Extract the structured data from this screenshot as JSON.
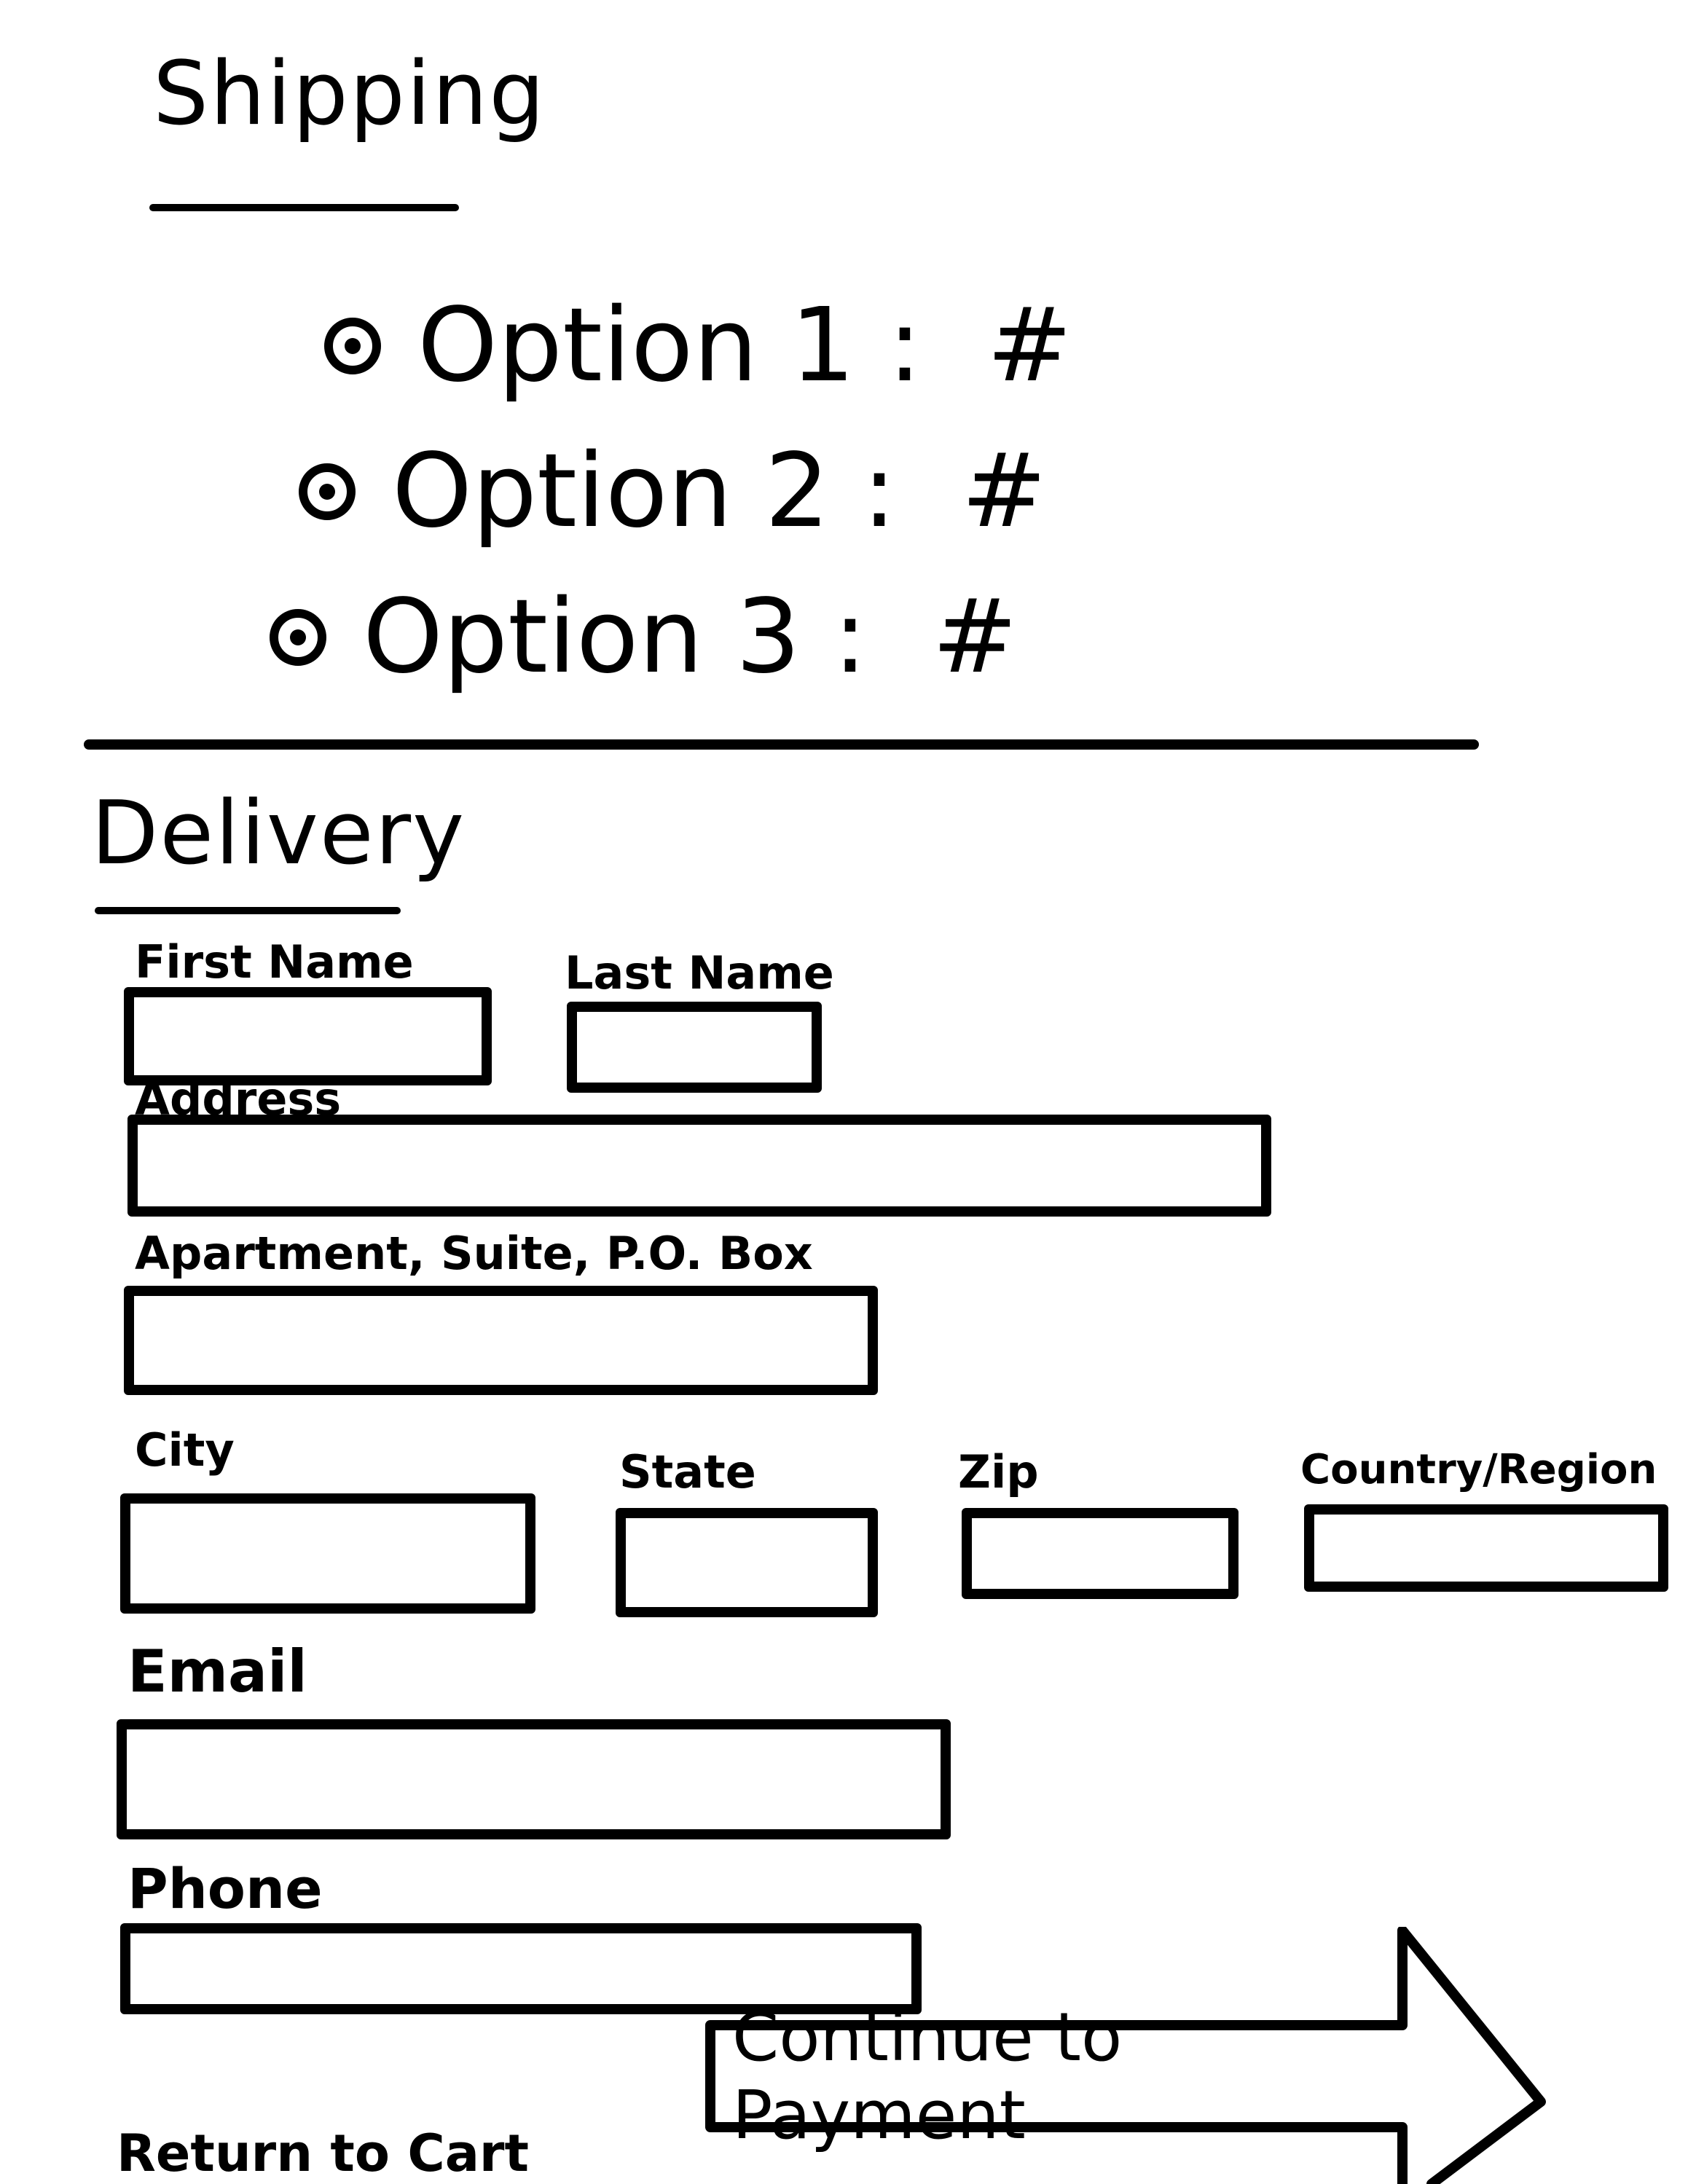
{
  "shipping": {
    "title": "Shipping",
    "options": [
      {
        "label": "Option 1 :  #"
      },
      {
        "label": "Option 2 :  #"
      },
      {
        "label": "Option 3 :  #"
      }
    ]
  },
  "delivery": {
    "title": "Delivery",
    "fields": {
      "first_name": "First Name",
      "last_name": "Last Name",
      "address": "Address",
      "apartment": "Apartment, Suite, P.O. Box",
      "city": "City",
      "state": "State",
      "zip": "Zip",
      "country": "Country/Region",
      "email": "Email",
      "phone": "Phone"
    }
  },
  "actions": {
    "continue_label": "Continue to Payment",
    "return_label": "Return to Cart"
  }
}
